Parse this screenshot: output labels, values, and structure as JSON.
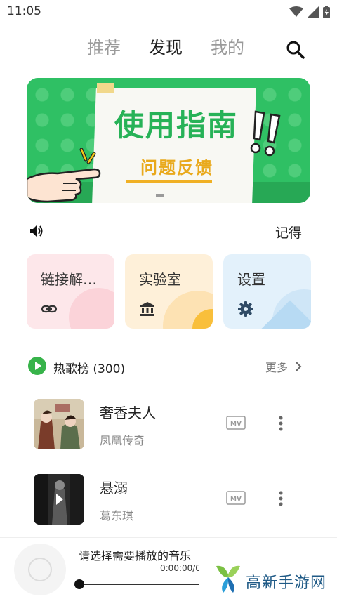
{
  "status_bar": {
    "time": "11:05",
    "icons": [
      "wifi-icon",
      "signal-icon",
      "battery-charging-icon"
    ]
  },
  "top_tabs": [
    {
      "label": "推荐",
      "active": false
    },
    {
      "label": "发现",
      "active": true
    },
    {
      "label": "我的",
      "active": false
    }
  ],
  "banner": {
    "title": "使用指南",
    "subtitle": "问题反馈",
    "colors": {
      "green": "#2fc064",
      "yellow": "#e9a91c"
    }
  },
  "notice": {
    "text": "记得",
    "icon": "speaker-icon"
  },
  "feature_cards": [
    {
      "label": "链接解…",
      "icon": "link-icon",
      "color": "#fde7ea"
    },
    {
      "label": "实验室",
      "icon": "bank-icon",
      "color": "#fef0d9"
    },
    {
      "label": "设置",
      "icon": "gear-icon",
      "color": "#e3f1fb"
    }
  ],
  "hot_list": {
    "title": "热歌榜 (300)",
    "more_label": "更多",
    "accent": "#37b34a",
    "songs": [
      {
        "title": "奢香夫人",
        "artist": "凤凰传奇",
        "badge": "MV"
      },
      {
        "title": "悬溺",
        "artist": "葛东琪",
        "badge": "MV"
      }
    ]
  },
  "player": {
    "title": "请选择需要播放的音乐",
    "time": "0:00:00/0:00:00",
    "progress": 0
  },
  "watermark": {
    "text": "高新手游网"
  }
}
